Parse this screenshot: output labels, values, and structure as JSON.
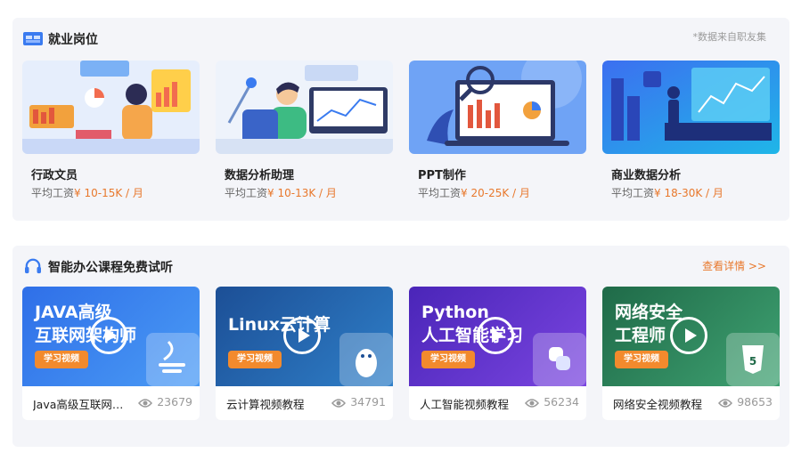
{
  "jobs_section": {
    "title": "就业岗位",
    "note": "*数据来自职友集",
    "salary_prefix": "平均工资",
    "cards": [
      {
        "title": "行政文员",
        "salary": "¥ 10-15K / 月"
      },
      {
        "title": "数据分析助理",
        "salary": "¥ 10-13K / 月"
      },
      {
        "title": "PPT制作",
        "salary": "¥ 20-25K / 月"
      },
      {
        "title": "商业数据分析",
        "salary": "¥ 18-30K / 月"
      }
    ]
  },
  "courses_section": {
    "title": "智能办公课程免费试听",
    "more_link": "查看详情 >>",
    "badge": "学习视频",
    "cards": [
      {
        "thumb_title": "JAVA高级\n互联网架构师",
        "label": "Java高级互联网架构师",
        "views": "23679"
      },
      {
        "thumb_title": "Linux云计算",
        "label": "云计算视频教程",
        "views": "34791"
      },
      {
        "thumb_title": "Python\n人工智能学习",
        "label": "人工智能视频教程",
        "views": "56234"
      },
      {
        "thumb_title": "网络安全\n工程师",
        "label": "网络安全视频教程",
        "views": "98653"
      }
    ]
  },
  "colors": {
    "accent": "#e8782c",
    "panel_bg": "#f4f5f9",
    "course_gradients": [
      "#2f6fe8",
      "#1f5fa8",
      "#5a2fc8",
      "#2a7a55"
    ]
  }
}
